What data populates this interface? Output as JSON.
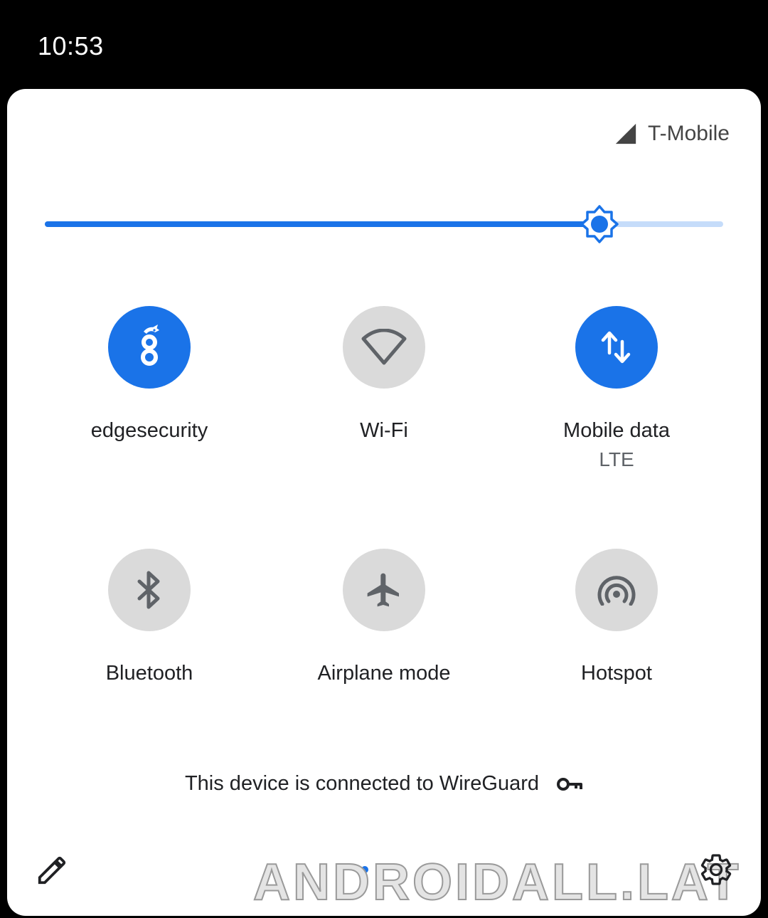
{
  "status_bar": {
    "time": "10:53"
  },
  "header": {
    "carrier": "T-Mobile",
    "signal_icon": "cell-signal-icon"
  },
  "brightness": {
    "level": 0.818,
    "icon": "brightness-icon",
    "colors": {
      "fill": "#1a73e8",
      "track": "#c5dcfa"
    }
  },
  "tiles": [
    {
      "label": "edgesecurity",
      "sublabel": "",
      "state": "on",
      "icon": "wireguard-icon"
    },
    {
      "label": "Wi-Fi",
      "sublabel": "",
      "state": "off",
      "icon": "wifi-icon"
    },
    {
      "label": "Mobile data",
      "sublabel": "LTE",
      "state": "on",
      "icon": "mobile-data-icon"
    },
    {
      "label": "Bluetooth",
      "sublabel": "",
      "state": "off",
      "icon": "bluetooth-icon"
    },
    {
      "label": "Airplane mode",
      "sublabel": "",
      "state": "off",
      "icon": "airplane-icon"
    },
    {
      "label": "Hotspot",
      "sublabel": "",
      "state": "off",
      "icon": "hotspot-icon"
    }
  ],
  "vpn_footer": {
    "text": "This device is connected to WireGuard",
    "icon": "key-icon"
  },
  "footer": {
    "edit_icon": "pencil-icon",
    "settings_icon": "gear-icon",
    "page_indicator": {
      "pages": 2,
      "current": 1
    }
  },
  "watermark": "ANDROIDALL.LAT",
  "colors": {
    "accent": "#1a73e8",
    "tile_off": "#dadada",
    "icon_off": "#5f6368"
  }
}
